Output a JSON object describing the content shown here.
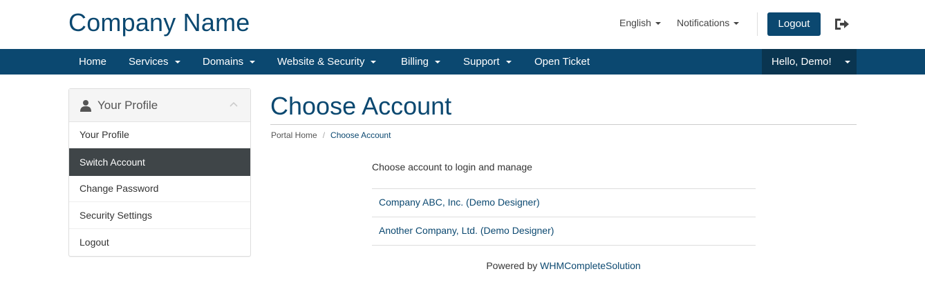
{
  "header": {
    "logo": "Company Name",
    "language": "English",
    "notifications": "Notifications",
    "logout_label": "Logout",
    "signout_icon": "sign-out-icon"
  },
  "nav": {
    "items": [
      {
        "label": "Home",
        "dropdown": false
      },
      {
        "label": "Services",
        "dropdown": true
      },
      {
        "label": "Domains",
        "dropdown": true
      },
      {
        "label": "Website & Security",
        "dropdown": true
      },
      {
        "label": "Billing",
        "dropdown": true
      },
      {
        "label": "Support",
        "dropdown": true
      },
      {
        "label": "Open Ticket",
        "dropdown": false
      }
    ],
    "user": "Hello, Demo!"
  },
  "sidebar": {
    "title": "Your Profile",
    "items": [
      {
        "label": "Your Profile",
        "active": false
      },
      {
        "label": "Switch Account",
        "active": true
      },
      {
        "label": "Change Password",
        "active": false
      },
      {
        "label": "Security Settings",
        "active": false
      },
      {
        "label": "Logout",
        "active": false
      }
    ]
  },
  "main": {
    "title": "Choose Account",
    "breadcrumb": [
      "Portal Home",
      "Choose Account"
    ],
    "intro": "Choose account to login and manage",
    "accounts": [
      "Company ABC, Inc. (Demo Designer)",
      "Another Company, Ltd. (Demo Designer)"
    ]
  },
  "footer": {
    "prefix": "Powered by ",
    "link": "WHMCompleteSolution"
  },
  "colors": {
    "brand": "#0b4870",
    "nav_user_bg": "#0a3550",
    "active_item_bg": "#3f4548"
  }
}
